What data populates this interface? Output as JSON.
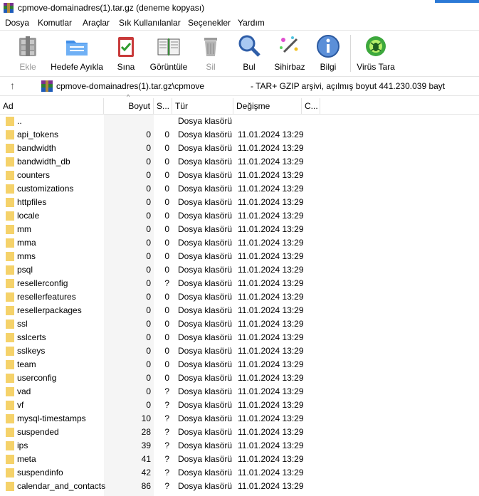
{
  "window": {
    "title": "cpmove-domainadres(1).tar.gz (deneme kopyası)"
  },
  "menu": [
    "Dosya",
    "Komutlar",
    "Araçlar",
    "Sık Kullanılanlar",
    "Seçenekler",
    "Yardım"
  ],
  "toolbar": {
    "extract_label": "Ekle",
    "extract_to_label": "Hedefe Ayıkla",
    "test_label": "Sına",
    "view_label": "Görüntüle",
    "delete_label": "Sil",
    "find_label": "Bul",
    "wizard_label": "Sihirbaz",
    "info_label": "Bilgi",
    "virus_label": "Virüs Tara"
  },
  "address": {
    "path": "cpmove-domainadres(1).tar.gz\\cpmove",
    "description": "- TAR+ GZIP arşivi, açılmış boyut 441.230.039 bayt"
  },
  "columns": {
    "name": "Ad",
    "size": "Boyut",
    "packed": "S...",
    "type": "Tür",
    "modified": "Değişme",
    "crc": "C..."
  },
  "colors": {
    "folder": "#f5d26a",
    "accent": "#2b79d6"
  },
  "rows": [
    {
      "name": "..",
      "size": "",
      "packed": "",
      "type": "Dosya klasörü",
      "modified": ""
    },
    {
      "name": "api_tokens",
      "size": "0",
      "packed": "0",
      "type": "Dosya klasörü",
      "modified": "11.01.2024 13:29"
    },
    {
      "name": "bandwidth",
      "size": "0",
      "packed": "0",
      "type": "Dosya klasörü",
      "modified": "11.01.2024 13:29"
    },
    {
      "name": "bandwidth_db",
      "size": "0",
      "packed": "0",
      "type": "Dosya klasörü",
      "modified": "11.01.2024 13:29"
    },
    {
      "name": "counters",
      "size": "0",
      "packed": "0",
      "type": "Dosya klasörü",
      "modified": "11.01.2024 13:29"
    },
    {
      "name": "customizations",
      "size": "0",
      "packed": "0",
      "type": "Dosya klasörü",
      "modified": "11.01.2024 13:29"
    },
    {
      "name": "httpfiles",
      "size": "0",
      "packed": "0",
      "type": "Dosya klasörü",
      "modified": "11.01.2024 13:29"
    },
    {
      "name": "locale",
      "size": "0",
      "packed": "0",
      "type": "Dosya klasörü",
      "modified": "11.01.2024 13:29"
    },
    {
      "name": "mm",
      "size": "0",
      "packed": "0",
      "type": "Dosya klasörü",
      "modified": "11.01.2024 13:29"
    },
    {
      "name": "mma",
      "size": "0",
      "packed": "0",
      "type": "Dosya klasörü",
      "modified": "11.01.2024 13:29"
    },
    {
      "name": "mms",
      "size": "0",
      "packed": "0",
      "type": "Dosya klasörü",
      "modified": "11.01.2024 13:29"
    },
    {
      "name": "psql",
      "size": "0",
      "packed": "0",
      "type": "Dosya klasörü",
      "modified": "11.01.2024 13:29"
    },
    {
      "name": "resellerconfig",
      "size": "0",
      "packed": "?",
      "type": "Dosya klasörü",
      "modified": "11.01.2024 13:29"
    },
    {
      "name": "resellerfeatures",
      "size": "0",
      "packed": "0",
      "type": "Dosya klasörü",
      "modified": "11.01.2024 13:29"
    },
    {
      "name": "resellerpackages",
      "size": "0",
      "packed": "0",
      "type": "Dosya klasörü",
      "modified": "11.01.2024 13:29"
    },
    {
      "name": "ssl",
      "size": "0",
      "packed": "0",
      "type": "Dosya klasörü",
      "modified": "11.01.2024 13:29"
    },
    {
      "name": "sslcerts",
      "size": "0",
      "packed": "0",
      "type": "Dosya klasörü",
      "modified": "11.01.2024 13:29"
    },
    {
      "name": "sslkeys",
      "size": "0",
      "packed": "0",
      "type": "Dosya klasörü",
      "modified": "11.01.2024 13:29"
    },
    {
      "name": "team",
      "size": "0",
      "packed": "0",
      "type": "Dosya klasörü",
      "modified": "11.01.2024 13:29"
    },
    {
      "name": "userconfig",
      "size": "0",
      "packed": "0",
      "type": "Dosya klasörü",
      "modified": "11.01.2024 13:29"
    },
    {
      "name": "vad",
      "size": "0",
      "packed": "?",
      "type": "Dosya klasörü",
      "modified": "11.01.2024 13:29"
    },
    {
      "name": "vf",
      "size": "0",
      "packed": "?",
      "type": "Dosya klasörü",
      "modified": "11.01.2024 13:29"
    },
    {
      "name": "mysql-timestamps",
      "size": "10",
      "packed": "?",
      "type": "Dosya klasörü",
      "modified": "11.01.2024 13:29"
    },
    {
      "name": "suspended",
      "size": "28",
      "packed": "?",
      "type": "Dosya klasörü",
      "modified": "11.01.2024 13:29"
    },
    {
      "name": "ips",
      "size": "39",
      "packed": "?",
      "type": "Dosya klasörü",
      "modified": "11.01.2024 13:29"
    },
    {
      "name": "meta",
      "size": "41",
      "packed": "?",
      "type": "Dosya klasörü",
      "modified": "11.01.2024 13:29"
    },
    {
      "name": "suspendinfo",
      "size": "42",
      "packed": "?",
      "type": "Dosya klasörü",
      "modified": "11.01.2024 13:29"
    },
    {
      "name": "calendar_and_contacts",
      "size": "86",
      "packed": "?",
      "type": "Dosya klasörü",
      "modified": "11.01.2024 13:29"
    }
  ]
}
